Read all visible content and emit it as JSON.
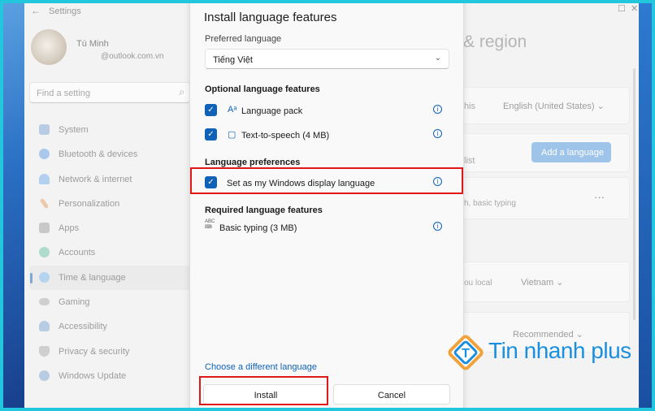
{
  "window": {
    "back_icon": "back-arrow-icon",
    "title": "Settings",
    "controls": [
      "minimize-icon",
      "maximize-icon",
      "close-icon"
    ]
  },
  "profile": {
    "name": "Tú Minh",
    "email": "@outlook.com.vn"
  },
  "search": {
    "placeholder": "Find a setting",
    "icon": "search-icon"
  },
  "nav": [
    {
      "label": "System",
      "icon": "monitor-icon",
      "color": "#7fa7d0"
    },
    {
      "label": "Bluetooth & devices",
      "icon": "bluetooth-icon",
      "color": "#6aa0dd"
    },
    {
      "label": "Network & internet",
      "icon": "wifi-icon",
      "color": "#7aaee0"
    },
    {
      "label": "Personalization",
      "icon": "brush-icon",
      "color": "#d8a47a"
    },
    {
      "label": "Apps",
      "icon": "apps-icon",
      "color": "#9a9a9a"
    },
    {
      "label": "Accounts",
      "icon": "person-icon",
      "color": "#6ec0a8"
    },
    {
      "label": "Time & language",
      "icon": "globe-clock-icon",
      "color": "#7fb3e0",
      "active": true
    },
    {
      "label": "Gaming",
      "icon": "controller-icon",
      "color": "#a0a0a0"
    },
    {
      "label": "Accessibility",
      "icon": "accessibility-icon",
      "color": "#7fa7d0"
    },
    {
      "label": "Privacy & security",
      "icon": "shield-icon",
      "color": "#a0a0a0"
    },
    {
      "label": "Windows Update",
      "icon": "update-icon",
      "color": "#7fa7d0"
    }
  ],
  "background": {
    "title_fragment": "& region",
    "row1_fragment": "his",
    "row1_value": "English (United States)",
    "row2_fragment": "list",
    "add_language_button": "Add a language",
    "row3_fragment": "h, basic typing",
    "more_icon": "more-icon",
    "row4_fragment": "ou local",
    "row4_value": "Vietnam",
    "row5_value": "Recommended"
  },
  "dialog": {
    "title": "Install language features",
    "preferred_label": "Preferred language",
    "preferred_value": "Tiếng Việt",
    "optional_heading": "Optional language features",
    "optional": [
      {
        "label": "Language pack",
        "checked": true,
        "icon": "language-pack-icon"
      },
      {
        "label": "Text-to-speech (4 MB)",
        "checked": true,
        "icon": "speech-icon"
      }
    ],
    "pref_heading": "Language preferences",
    "pref_item": {
      "label": "Set as my Windows display language",
      "checked": true
    },
    "required_heading": "Required language features",
    "required_item": {
      "label": "Basic typing (3 MB)",
      "icon": "basic-typing-icon"
    },
    "choose_link": "Choose a different language",
    "install_button": "Install",
    "cancel_button": "Cancel",
    "highlight_color": "#e01818",
    "accent": "#0f62b8"
  },
  "watermark": {
    "text": "Tin nhanh plus",
    "color": "#1a8fe0"
  }
}
